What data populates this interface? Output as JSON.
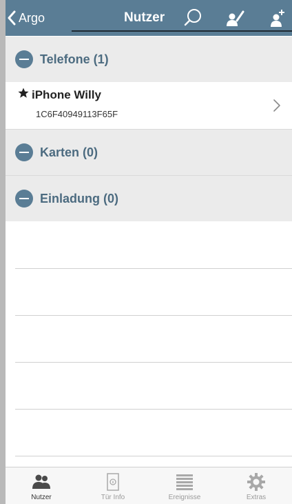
{
  "navbar": {
    "back_label": "Argo",
    "title": "Nutzer"
  },
  "sections": [
    {
      "title": "Telefone (1)"
    },
    {
      "title": "Karten (0)"
    },
    {
      "title": "Einladung (0)"
    }
  ],
  "devices": [
    {
      "name": "iPhone Willy",
      "id": "1C6F40949113F65F",
      "favorite": true
    }
  ],
  "tabs": [
    {
      "label": "Nutzer",
      "icon": "users-icon",
      "active": true
    },
    {
      "label": "Tür Info",
      "icon": "door-info-icon",
      "active": false
    },
    {
      "label": "Ereignisse",
      "icon": "events-list-icon",
      "active": false
    },
    {
      "label": "Extras",
      "icon": "gear-icon",
      "active": false
    }
  ],
  "colors": {
    "accent": "#5a7d95",
    "section_text": "#4c6b80",
    "section_bg": "#ebebeb"
  }
}
